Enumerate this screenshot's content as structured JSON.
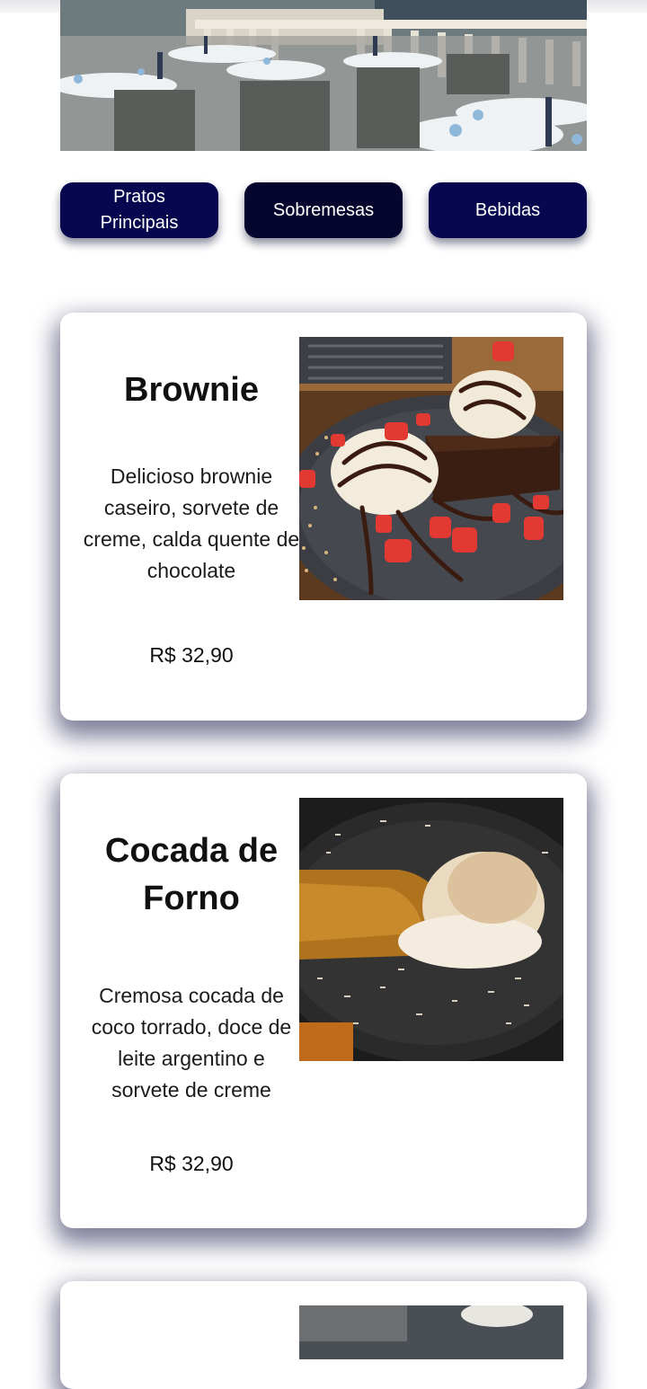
{
  "tabs": [
    {
      "label": "Pratos Principais",
      "active": false
    },
    {
      "label": "Sobremesas",
      "active": true
    },
    {
      "label": "Bebidas",
      "active": false
    }
  ],
  "items": [
    {
      "name": "Brownie",
      "description": "Delicioso brownie caseiro, sorvete de creme, calda quente de chocolate",
      "price": "R$ 32,90"
    },
    {
      "name": "Cocada de Forno",
      "description": "Cremosa cocada de coco torrado, doce de leite argentino e sorvete de creme",
      "price": "R$ 32,90"
    }
  ],
  "colors": {
    "tab_bg": "#07074f",
    "tab_active_bg": "#05052e",
    "card_shadow": "#14144a"
  }
}
